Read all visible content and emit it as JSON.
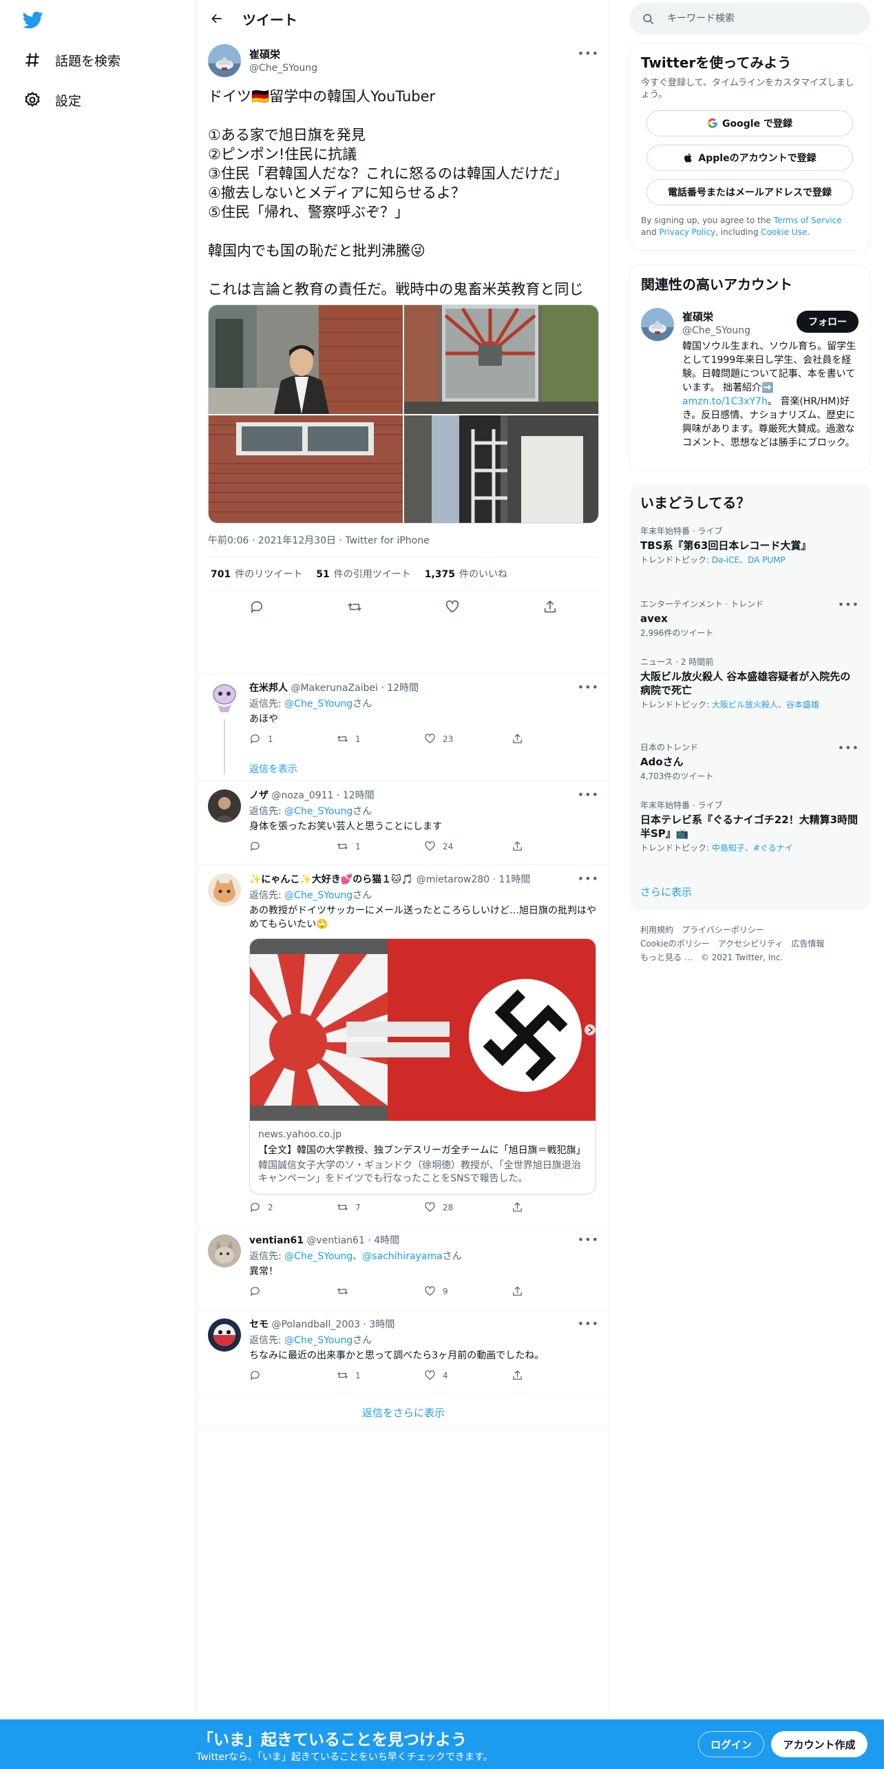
{
  "nav": {
    "explore_label": "話題を検索",
    "settings_label": "設定"
  },
  "header": {
    "title": "ツイート"
  },
  "tweet": {
    "name": "崔碩栄",
    "handle": "@Che_SYoung",
    "body": "ドイツ🇩🇪留学中の韓国人YouTuber\n\n①ある家で旭日旗を発見\n②ピンポン!住民に抗議\n③住民「君韓国人だな？これに怒るのは韓国人だけだ」\n④撤去しないとメディアに知らせるよ？\n⑤住民「帰れ、警察呼ぶぞ？」\n\n韓国内でも国の恥だと批判沸騰😜\n\nこれは言論と教育の責任だ。戦時中の鬼畜米英教育と同じ",
    "meta": "午前0:06 · 2021年12月30日 · Twitter for iPhone",
    "retweets_count": "701",
    "retweets_label": "件のリツイート",
    "quotes_count": "51",
    "quotes_label": "件の引用ツイート",
    "likes_count": "1,375",
    "likes_label": "件のいいね"
  },
  "replies": [
    {
      "name": "在米邦人",
      "handle": "@MakerunaZaibei",
      "time": "· 12時間",
      "reply_prefix": "返信先: ",
      "reply_to": "@Che_SYoung",
      "reply_suffix": "さん",
      "text": "あほや",
      "reply_count": "1",
      "retweet_count": "1",
      "like_count": "23",
      "show_replies": "返信を表示"
    },
    {
      "name": "ノザ",
      "handle": "@noza_0911",
      "time": "· 12時間",
      "reply_prefix": "返信先: ",
      "reply_to": "@Che_SYoung",
      "reply_suffix": "さん",
      "text": "身体を張ったお笑い芸人と思うことにします",
      "reply_count": "",
      "retweet_count": "1",
      "like_count": "24"
    },
    {
      "name": "✨にゃんこ✨大好き💕のら猫１🐱🎵",
      "handle": "@mietarow280",
      "time": "· 11時間",
      "reply_prefix": "返信先: ",
      "reply_to": "@Che_SYoung",
      "reply_suffix": "さん",
      "text": "あの教授がドイツサッカーにメール送ったところらしいけど…旭日旗の批判はやめてもらいたい🙄",
      "card": {
        "domain": "news.yahoo.co.jp",
        "title": "【全文】韓国の大学教授、独ブンデスリーガ全チームに「旭日旗＝戦犯旗」",
        "desc": "韓国誠信女子大学のソ・ギョンドク（徐坰徳）教授が、「全世界旭日旗退治キャンペーン」をドイツでも行なったことをSNSで報告した。"
      },
      "reply_count": "2",
      "retweet_count": "7",
      "like_count": "28"
    },
    {
      "name": "ventian61",
      "handle": "@ventian61",
      "time": "· 4時間",
      "reply_prefix": "返信先: ",
      "reply_to": "@Che_SYoung",
      "reply_sep": "、",
      "reply_to2": "@sachihirayama",
      "reply_suffix": "さん",
      "text": "異常！",
      "reply_count": "",
      "retweet_count": "",
      "like_count": "9"
    },
    {
      "name": "セモ",
      "handle": "@Polandball_2003",
      "time": "· 3時間",
      "reply_prefix": "返信先: ",
      "reply_to": "@Che_SYoung",
      "reply_suffix": "さん",
      "text": "ちなみに最近の出来事かと思って調べたら3ヶ月前の動画でしたね。",
      "reply_count": "",
      "retweet_count": "1",
      "like_count": "4"
    }
  ],
  "more_replies": "返信をさらに表示",
  "sidebar": {
    "search_placeholder": "キーワード検索",
    "signup": {
      "title": "Twitterを使ってみよう",
      "subtitle": "今すぐ登録して、タイムラインをカスタマイズしましょう。",
      "google": "Google で登録",
      "apple": "Appleのアカウントで登録",
      "phone": "電話番号またはメールアドレスで登録",
      "legal_1": "By signing up, you agree to the ",
      "legal_terms": "Terms of Service",
      "legal_2": " and ",
      "legal_privacy": "Privacy Policy",
      "legal_3": ", including ",
      "legal_cookie": "Cookie Use",
      "legal_4": "."
    },
    "related": {
      "title": "関連性の高いアカウント",
      "name": "崔碩栄",
      "handle": "@Che_SYoung",
      "follow": "フォロー",
      "bio_1": "韓国ソウル生まれ、ソウル育ち。留学生として1999年来日し学生、会社員を経験。日韓問題について記事、本を書いています。 拙著紹介➡️ ",
      "bio_link": "amzn.to/1C3xY7h",
      "bio_2": "。 音楽(HR/HM)好き。反日感情、ナショナリズム、歴史に興味があります。尊厳死大賛成。過激なコメント、思想などは勝手にブロック。"
    },
    "trends": {
      "title": "いまどうしてる？",
      "items": [
        {
          "meta": "年末年始特番 · ライブ",
          "name": "TBS系『第63回日本レコード大賞』",
          "sub_prefix": "トレンドトピック: ",
          "sub_links": "Da-iCE、DA PUMP"
        },
        {
          "meta": "エンターテインメント · トレンド",
          "name": "avex",
          "sub": "2,996件のツイート"
        },
        {
          "meta": "ニュース · 2 時間前",
          "name": "大阪ビル放火殺人 谷本盛雄容疑者が入院先の病院で死亡",
          "sub_prefix": "トレンドトピック: ",
          "sub_links": "大阪ビル放火殺人、谷本盛雄"
        },
        {
          "meta": "日本のトレンド",
          "name": "Adoさん",
          "sub": "4,703件のツイート"
        },
        {
          "meta": "年末年始特番 · ライブ",
          "name": "日本テレビ系『ぐるナイゴチ22！大精算3時間半SP』📺",
          "sub_prefix": "トレンドトピック: ",
          "sub_links": "中島知子、#ぐるナイ"
        }
      ],
      "show_more": "さらに表示"
    },
    "footer": {
      "terms": "利用規約",
      "privacy": "プライバシーポリシー",
      "cookie": "Cookieのポリシー",
      "accessibility": "アクセシビリティ",
      "ads": "広告情報",
      "more": "もっと見る …",
      "copyright": "© 2021 Twitter, Inc."
    }
  },
  "bottom_bar": {
    "title": "「いま」起きていることを見つけよう",
    "subtitle": "Twitterなら、「いま」起きていることをいち早くチェックできます。",
    "login": "ログイン",
    "signup": "アカウント作成"
  },
  "colors": {
    "accent": "#1d9bf0",
    "text": "#0f1419",
    "muted": "#536471"
  }
}
